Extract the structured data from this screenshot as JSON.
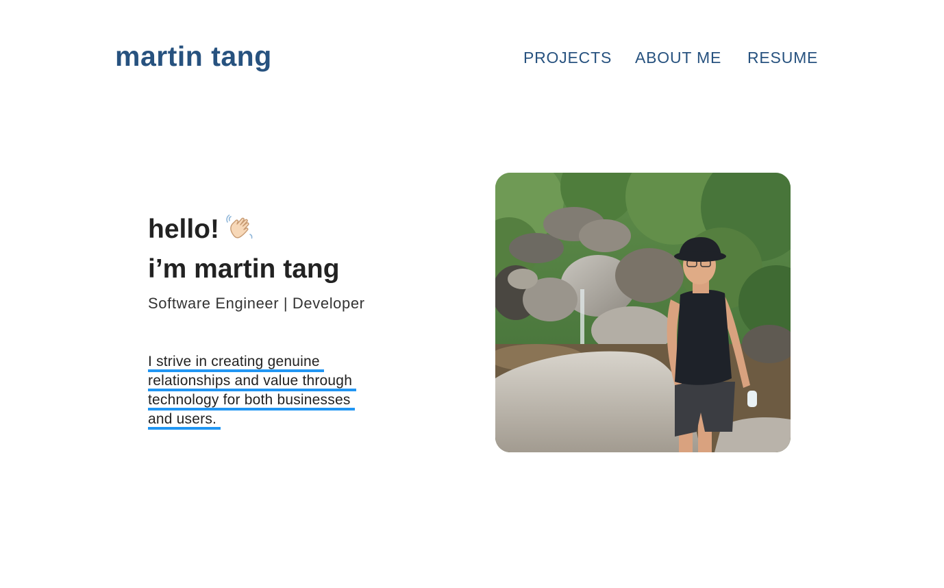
{
  "header": {
    "brand": "martin tang",
    "nav": {
      "projects": "PROJECTS",
      "about": "ABOUT ME",
      "resume": "RESUME"
    }
  },
  "hero": {
    "greeting": "hello!",
    "greeting_emoji": "waving-hand-icon",
    "name": "i’m martin tang",
    "role": "Software Engineer | Developer",
    "tagline_lines": [
      "I strive in creating genuine",
      "relationships and value through",
      "technology for both businesses",
      "and users."
    ]
  },
  "photo": {
    "subject": "person-in-bucket-hat-by-waterfall"
  },
  "colors": {
    "brand": "#27527f",
    "heading": "#222222",
    "underline": "#2196f3",
    "background": "#ffffff"
  }
}
